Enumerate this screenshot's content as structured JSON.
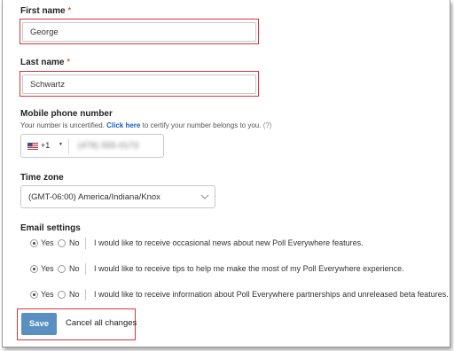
{
  "first_name": {
    "label": "First name",
    "required_mark": "*",
    "value": "George"
  },
  "last_name": {
    "label": "Last name",
    "required_mark": "*",
    "value": "Schwartz"
  },
  "phone": {
    "label": "Mobile phone number",
    "note_prefix": "Your number is uncertified.",
    "note_link": "Click here",
    "note_suffix": "to certify your number belongs to you.",
    "help": "(?)",
    "country_code": "+1",
    "number": "(479) 555-0173"
  },
  "timezone": {
    "label": "Time zone",
    "value": "(GMT-06:00) America/Indiana/Knox"
  },
  "email_settings": {
    "label": "Email settings",
    "yes_label": "Yes",
    "no_label": "No",
    "options": [
      {
        "text": "I would like to receive occasional news about new Poll Everywhere features.",
        "selected": "yes"
      },
      {
        "text": "I would like to receive tips to help me make the most of my Poll Everywhere experience.",
        "selected": "yes"
      },
      {
        "text": "I would like to receive information about Poll Everywhere partnerships and unreleased beta features.",
        "selected": "yes"
      }
    ]
  },
  "actions": {
    "save_label": "Save",
    "cancel_label": "Cancel all changes"
  },
  "colors": {
    "highlight": "#d9343b",
    "primary": "#5a8fc2",
    "link": "#1a5fb4",
    "required": "#d0312d"
  }
}
